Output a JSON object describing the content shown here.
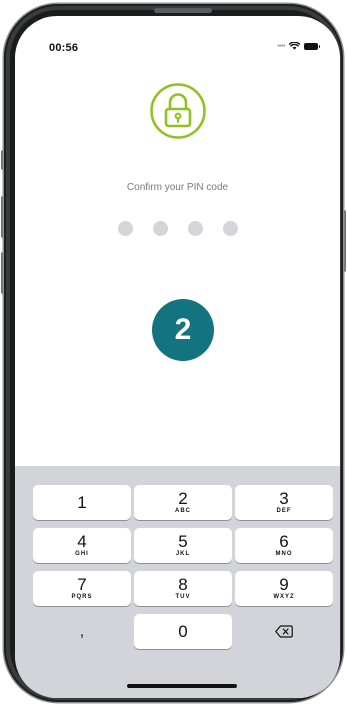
{
  "status_bar": {
    "time": "00:56",
    "signal_icon": "signal-dots-icon",
    "wifi_icon": "wifi-icon",
    "battery_icon": "battery-icon"
  },
  "lock": {
    "icon": "lock-icon",
    "color": "#8dc21f"
  },
  "prompt": "Confirm your PIN code",
  "pin": {
    "length": 4,
    "filled": 0
  },
  "step_badge": {
    "label": "2",
    "color": "#13737f"
  },
  "keypad": {
    "keys": [
      {
        "num": "1",
        "letters": ""
      },
      {
        "num": "2",
        "letters": "ABC"
      },
      {
        "num": "3",
        "letters": "DEF"
      },
      {
        "num": "4",
        "letters": "GHI"
      },
      {
        "num": "5",
        "letters": "JKL"
      },
      {
        "num": "6",
        "letters": "MNO"
      },
      {
        "num": "7",
        "letters": "PQRS"
      },
      {
        "num": "8",
        "letters": "TUV"
      },
      {
        "num": "9",
        "letters": "WXYZ"
      }
    ],
    "comma_key": ",",
    "zero_key": "0",
    "delete_icon": "backspace-icon"
  }
}
